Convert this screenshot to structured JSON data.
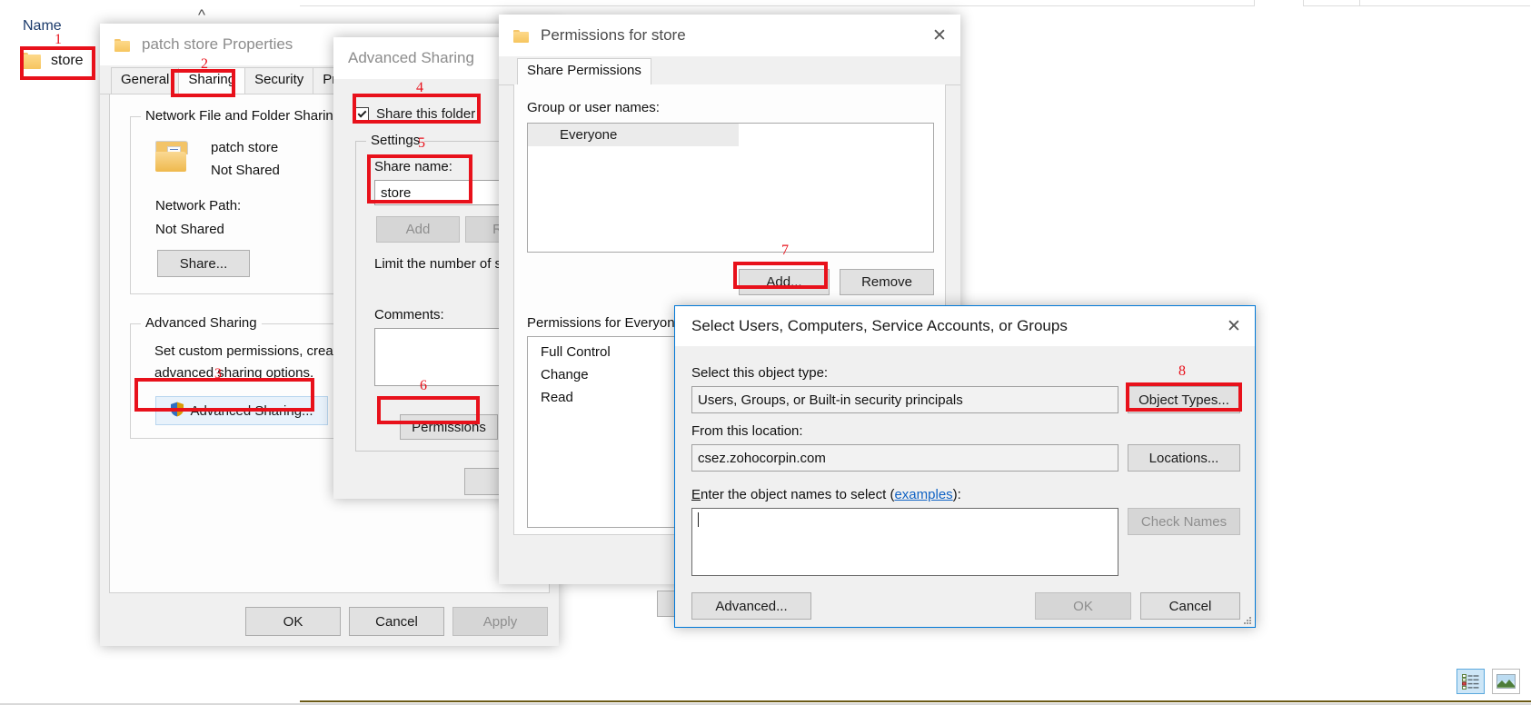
{
  "explorer": {
    "column_header": "Name",
    "file_item": "store",
    "folder_icon": "folder-icon",
    "chevron_icon": "chevron-up-icon",
    "view_details_icon": "details-view-icon",
    "view_tiles_icon": "large-icons-view-icon"
  },
  "properties_dialog": {
    "title": "patch store Properties",
    "title_icon": "folder-icon",
    "tabs": [
      {
        "label": "General",
        "active": false
      },
      {
        "label": "Sharing",
        "active": true
      },
      {
        "label": "Security",
        "active": false
      },
      {
        "label": "Previ",
        "active": false
      }
    ],
    "network_group": {
      "legend": "Network File and Folder Sharing",
      "folder_icon": "folder-document-icon",
      "share_name": "patch store",
      "share_state": "Not Shared",
      "network_path_label": "Network Path:",
      "network_path_value": "Not Shared",
      "share_button": "Share..."
    },
    "advanced_group": {
      "legend": "Advanced Sharing",
      "description_line1": "Set custom permissions, create m",
      "description_line2": "advanced sharing options.",
      "advanced_button": "Advanced Sharing...",
      "shield_icon": "uac-shield-icon"
    },
    "footer": {
      "ok": "OK",
      "cancel": "Cancel",
      "apply": "Apply"
    }
  },
  "advanced_sharing_dialog": {
    "title": "Advanced Sharing",
    "share_this_folder": "Share this folder",
    "settings_legend": "Settings",
    "share_name_label": "Share name:",
    "share_name_value": "store",
    "add_button": "Add",
    "remove_button": "Rem",
    "limit_text": "Limit the number of s",
    "comments_label": "Comments:",
    "permissions_button": "Permissions"
  },
  "permissions_dialog": {
    "title": "Permissions for store",
    "title_icon": "folder-icon",
    "close_icon": "close-icon",
    "tabs": [
      {
        "label": "Share Permissions",
        "active": true
      }
    ],
    "group_label": "Group or user names:",
    "entries": [
      {
        "name": "Everyone",
        "icon": "people-icon"
      }
    ],
    "add_button": "Add...",
    "remove_button": "Remove",
    "permissions_for_label": "Permissions for Everyone",
    "permission_rows": [
      "Full Control",
      "Change",
      "Read"
    ]
  },
  "select_users_dialog": {
    "title": "Select Users, Computers, Service Accounts, or Groups",
    "close_icon": "close-icon",
    "object_type_label": "Select this object type:",
    "object_type_value": "Users, Groups, or Built-in security principals",
    "object_types_button": "Object Types...",
    "location_label": "From this location:",
    "location_value": "csez.zohocorpin.com",
    "locations_button": "Locations...",
    "object_names_label_prefix": "E",
    "object_names_label": "nter the object names to select (",
    "object_names_link": "examples",
    "object_names_label_suffix": "):",
    "object_names_value": "",
    "check_names_button": "Check Names",
    "advanced_button": "Advanced...",
    "ok_button": "OK",
    "cancel_button": "Cancel"
  },
  "annotations": [
    {
      "n": "1"
    },
    {
      "n": "2"
    },
    {
      "n": "3"
    },
    {
      "n": "4"
    },
    {
      "n": "5"
    },
    {
      "n": "6"
    },
    {
      "n": "7"
    },
    {
      "n": "8"
    }
  ],
  "colors": {
    "highlight": "#e8111b",
    "link": "#0f62c4",
    "window_bg": "#f0f0f0"
  }
}
